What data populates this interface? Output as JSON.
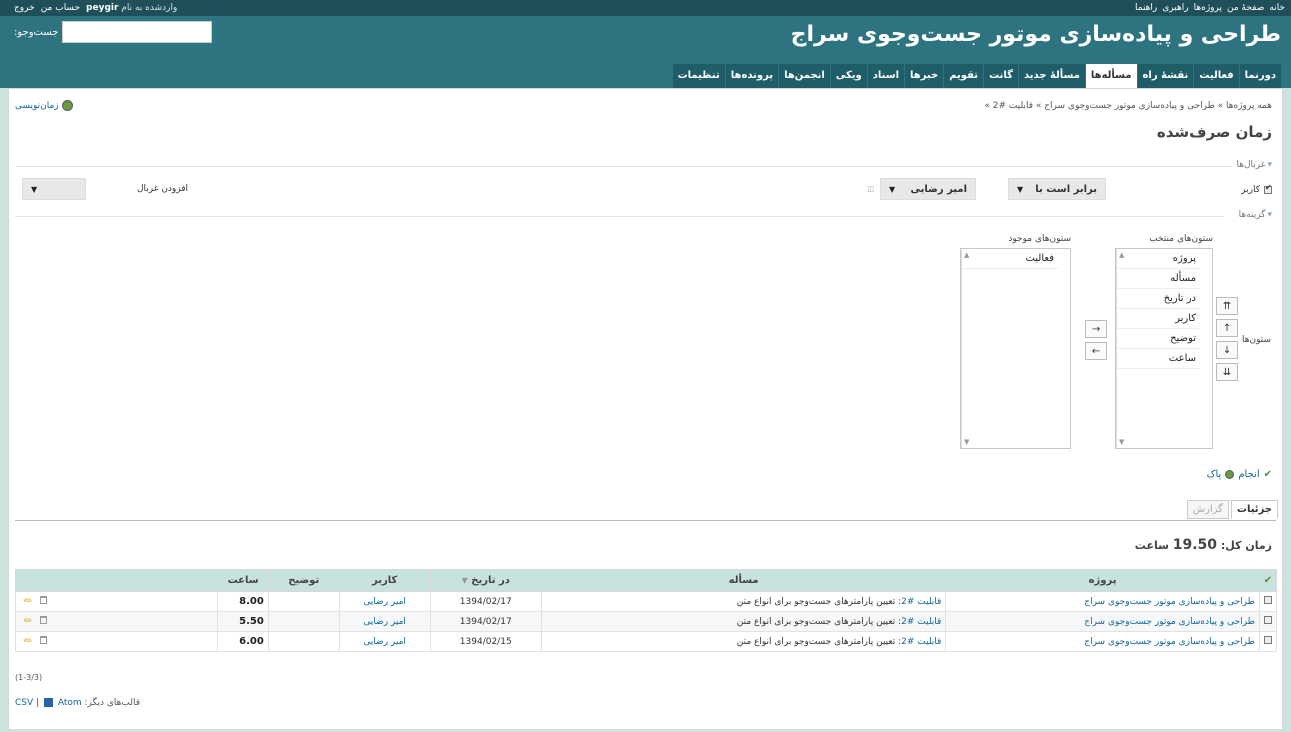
{
  "top_menu": {
    "links": [
      "خانه",
      "صفحهٔ من",
      "پروژه‌ها",
      "راهبری",
      "راهنما"
    ],
    "logged_prefix": "واردشده به نام",
    "username": "peygir",
    "account": "حساب من",
    "logout": "خروج"
  },
  "header": {
    "title": "طراحی و پیاده‌سازی موتور جست‌وجوی سراج",
    "search_label": "جست‌وجو:",
    "search_value": ""
  },
  "main_menu": {
    "tabs": [
      "دورنما",
      "فعالیت",
      "نقشهٔ راه",
      "مسأله‌ها",
      "مسألهٔ جدید",
      "گانت",
      "تقویم",
      "خبرها",
      "اسناد",
      "ویکی",
      "انجمن‌ها",
      "پرونده‌ها",
      "تنظیمات"
    ],
    "selected": "مسأله‌ها"
  },
  "breadcrumb": "همه پروژه‌ها » طراحی و پیاده‌سازی موتور جست‌وجوی سراج » قابلیت #2 »",
  "contextual_link": "زمان‌نویسی",
  "page_title": "زمان صرف‌شده",
  "filters": {
    "legend": "غربال‌ها",
    "field_label": "کاربر",
    "operator": "برابر است با",
    "value": "امیر رضایی",
    "add_filter_label": "افزودن غربال",
    "add_filter_value": ""
  },
  "options": {
    "legend": "گزینه‌ها",
    "columns_label": "ستون‌ها",
    "available_label": "ستون‌های موجود",
    "selected_label": "ستون‌های منتخب",
    "available": [
      "فعالیت"
    ],
    "selected": [
      "پروژه",
      "مسأله",
      "در تاریخ",
      "کاربر",
      "توضیح",
      "ساعت"
    ],
    "move_top": "⇈",
    "move_up": "↑",
    "move_down": "↓",
    "move_bottom": "⇊",
    "move_right": "→",
    "move_left": "←"
  },
  "actions": {
    "apply": "انجام",
    "clear": "پاک"
  },
  "tabs": {
    "details": "جزئیات",
    "report": "گزارش"
  },
  "total": {
    "label": "زمان کل:",
    "value": "19.50",
    "unit": "ساعت"
  },
  "table": {
    "headers": {
      "project": "پروژه",
      "issue": "مسأله",
      "date": "در تاریخ",
      "user": "کاربر",
      "comments": "توضیح",
      "hours": "ساعت"
    },
    "rows": [
      {
        "project": "طراحی و پیاده‌سازی موتور جست‌وجوی سراج",
        "issue_link": "قابلیت #2",
        "issue_text": ": تعیین پارامترهای جست‌وجو برای انواع متن",
        "date": "1394/02/17",
        "user": "امیر رضایی",
        "comments": "",
        "hours": "8.00"
      },
      {
        "project": "طراحی و پیاده‌سازی موتور جست‌وجوی سراج",
        "issue_link": "قابلیت #2",
        "issue_text": ": تعیین پارامترهای جست‌وجو برای انواع متن",
        "date": "1394/02/17",
        "user": "امیر رضایی",
        "comments": "",
        "hours": "5.50"
      },
      {
        "project": "طراحی و پیاده‌سازی موتور جست‌وجوی سراج",
        "issue_link": "قابلیت #2",
        "issue_text": ": تعیین پارامترهای جست‌وجو برای انواع متن",
        "date": "1394/02/15",
        "user": "امیر رضایی",
        "comments": "",
        "hours": "6.00"
      }
    ]
  },
  "pagination": "(1-3/3)",
  "other_formats": {
    "label": "قالب‌های دیگر:",
    "atom": "Atom",
    "sep": "|",
    "csv": "CSV"
  }
}
